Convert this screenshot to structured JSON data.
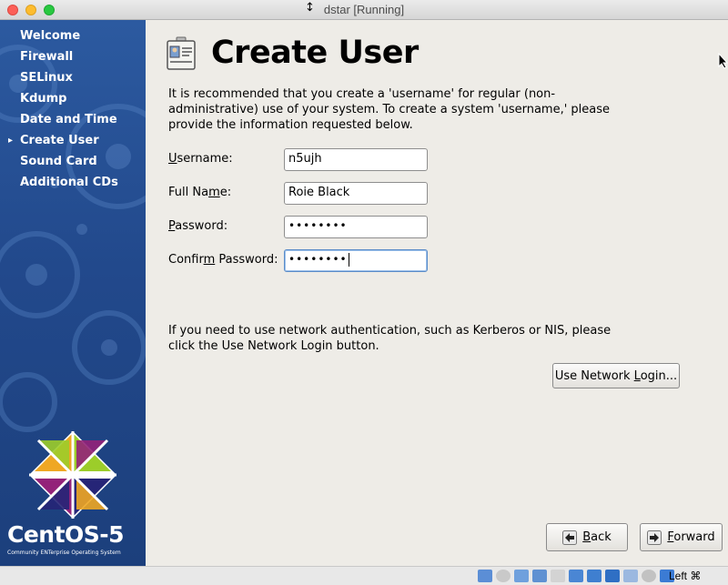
{
  "window": {
    "title": "dstar [Running]"
  },
  "sidebar": {
    "steps": [
      {
        "label": "Welcome",
        "current": false
      },
      {
        "label": "Firewall",
        "current": false
      },
      {
        "label": "SELinux",
        "current": false
      },
      {
        "label": "Kdump",
        "current": false
      },
      {
        "label": "Date and Time",
        "current": false
      },
      {
        "label": "Create User",
        "current": true
      },
      {
        "label": "Sound Card",
        "current": false
      },
      {
        "label": "Additional CDs",
        "current": false
      }
    ],
    "brand": {
      "name": "CentOS-5",
      "tagline": "Community ENTerprise Operating System"
    }
  },
  "main": {
    "title": "Create User",
    "intro": "It is recommended that you create a 'username' for regular (non-administrative) use of your system. To create a system 'username,' please provide the information requested below.",
    "fields": {
      "username": {
        "label_pre": "",
        "label_mn": "U",
        "label_post": "sername:",
        "value": "n5ujh"
      },
      "fullname": {
        "label_pre": "Full Na",
        "label_mn": "m",
        "label_post": "e:",
        "value": "Roie Black"
      },
      "password": {
        "label_pre": "",
        "label_mn": "P",
        "label_post": "assword:",
        "value": "••••••••"
      },
      "confirm": {
        "label_pre": "Confir",
        "label_mn": "m",
        "label_post": " Password:",
        "value": "••••••••"
      }
    },
    "network_note": "If you need to use network authentication, such as Kerberos or NIS, please click the Use Network Login button.",
    "network_button": {
      "pre": "Use Network ",
      "mn": "L",
      "post": "ogin..."
    },
    "back_button": {
      "pre": "",
      "mn": "B",
      "post": "ack"
    },
    "forward_button": {
      "pre": "",
      "mn": "F",
      "post": "orward"
    }
  },
  "statusbar": {
    "host_key": "Left ⌘"
  },
  "colors": {
    "sidebar": "#22498c",
    "background": "#eeece7",
    "focus": "#5a8cc8"
  }
}
